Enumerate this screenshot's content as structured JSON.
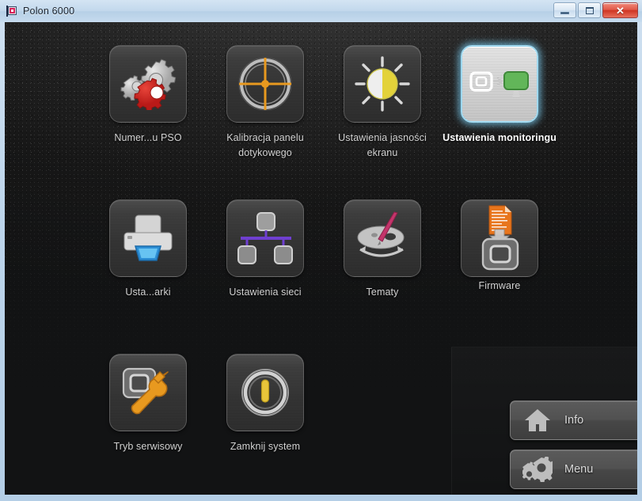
{
  "window": {
    "title": "Polon 6000",
    "app_icon": "polon-flag-icon",
    "controls": [
      {
        "name": "minimize-button",
        "glyph": "minimize-icon"
      },
      {
        "name": "maximize-button",
        "glyph": "maximize-icon"
      },
      {
        "name": "close-button",
        "glyph": "close-icon",
        "color": "#cf3524"
      }
    ]
  },
  "screen": {
    "background_color": "#131415",
    "selection_glow_color": "#9fd8ef"
  },
  "grid": {
    "items": [
      {
        "label": "Numer...u PSO",
        "icon": "gears-icon",
        "selected": false,
        "row": 1,
        "col": 1
      },
      {
        "label": "Kalibracja panelu dotykowego",
        "icon": "crosshair-target-icon",
        "selected": false,
        "row": 1,
        "col": 2
      },
      {
        "label": "Ustawienia jasności ekranu",
        "icon": "brightness-sun-icon",
        "selected": false,
        "row": 1,
        "col": 3
      },
      {
        "label": "Ustawienia monitoringu",
        "icon": "monitoring-screens-icon",
        "selected": true,
        "row": 1,
        "col": 4
      },
      {
        "label": "Usta...arki",
        "icon": "printer-icon",
        "selected": false,
        "row": 2,
        "col": 1
      },
      {
        "label": "Ustawienia sieci",
        "icon": "network-icon",
        "selected": false,
        "row": 2,
        "col": 2
      },
      {
        "label": "Tematy",
        "icon": "palette-brush-icon",
        "selected": false,
        "row": 2,
        "col": 3
      },
      {
        "label": "Firmware",
        "icon": "firmware-upload-icon",
        "selected": false,
        "row": 2,
        "col": 4
      },
      {
        "label": "Tryb serwisowy",
        "icon": "service-wrench-icon",
        "selected": false,
        "row": 3,
        "col": 1
      },
      {
        "label": "Zamknij system",
        "icon": "power-off-icon",
        "selected": false,
        "row": 3,
        "col": 2
      }
    ]
  },
  "actions": {
    "info": {
      "label": "Info",
      "icon": "home-icon"
    },
    "menu": {
      "label": "Menu",
      "icon": "gears-small-icon"
    }
  }
}
